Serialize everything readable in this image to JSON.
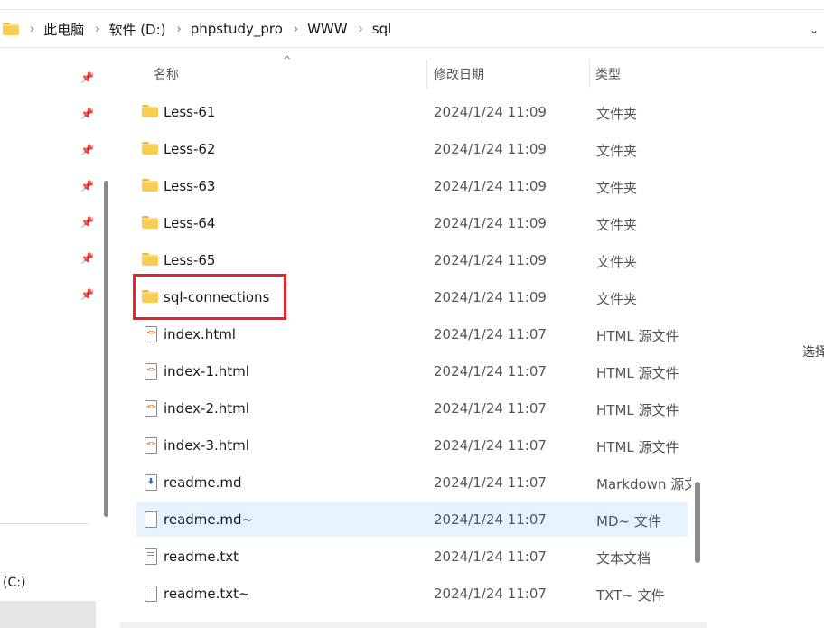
{
  "breadcrumb": [
    "此电脑",
    "软件 (D:)",
    "phpstudy_pro",
    "WWW",
    "sql"
  ],
  "columns": {
    "name": "名称",
    "date": "修改日期",
    "type": "类型"
  },
  "files": [
    {
      "name": "Less-61",
      "date": "2024/1/24 11:09",
      "type": "文件夹",
      "icon": "folder-icon"
    },
    {
      "name": "Less-62",
      "date": "2024/1/24 11:09",
      "type": "文件夹",
      "icon": "folder-icon"
    },
    {
      "name": "Less-63",
      "date": "2024/1/24 11:09",
      "type": "文件夹",
      "icon": "folder-icon"
    },
    {
      "name": "Less-64",
      "date": "2024/1/24 11:09",
      "type": "文件夹",
      "icon": "folder-icon"
    },
    {
      "name": "Less-65",
      "date": "2024/1/24 11:09",
      "type": "文件夹",
      "icon": "folder-icon"
    },
    {
      "name": "sql-connections",
      "date": "2024/1/24 11:09",
      "type": "文件夹",
      "icon": "folder-icon"
    },
    {
      "name": "index.html",
      "date": "2024/1/24 11:07",
      "type": "HTML 源文件",
      "icon": "html-file-icon"
    },
    {
      "name": "index-1.html",
      "date": "2024/1/24 11:07",
      "type": "HTML 源文件",
      "icon": "html-file-icon"
    },
    {
      "name": "index-2.html",
      "date": "2024/1/24 11:07",
      "type": "HTML 源文件",
      "icon": "html-file-icon"
    },
    {
      "name": "index-3.html",
      "date": "2024/1/24 11:07",
      "type": "HTML 源文件",
      "icon": "html-file-icon"
    },
    {
      "name": "readme.md",
      "date": "2024/1/24 11:07",
      "type": "Markdown 源文件",
      "icon": "markdown-file-icon"
    },
    {
      "name": "readme.md~",
      "date": "2024/1/24 11:07",
      "type": "MD~ 文件",
      "icon": "blank-file-icon"
    },
    {
      "name": "readme.txt",
      "date": "2024/1/24 11:07",
      "type": "文本文档",
      "icon": "text-file-icon"
    },
    {
      "name": "readme.txt~",
      "date": "2024/1/24 11:07",
      "type": "TXT~ 文件",
      "icon": "blank-file-icon"
    }
  ],
  "nav": {
    "drive_label": "(C:)"
  },
  "details_pane": {
    "text": "选择"
  },
  "colors": {
    "highlight_border": "#e8242a",
    "selected_row": "#e5f3ff",
    "folder": "#f7cd54"
  }
}
